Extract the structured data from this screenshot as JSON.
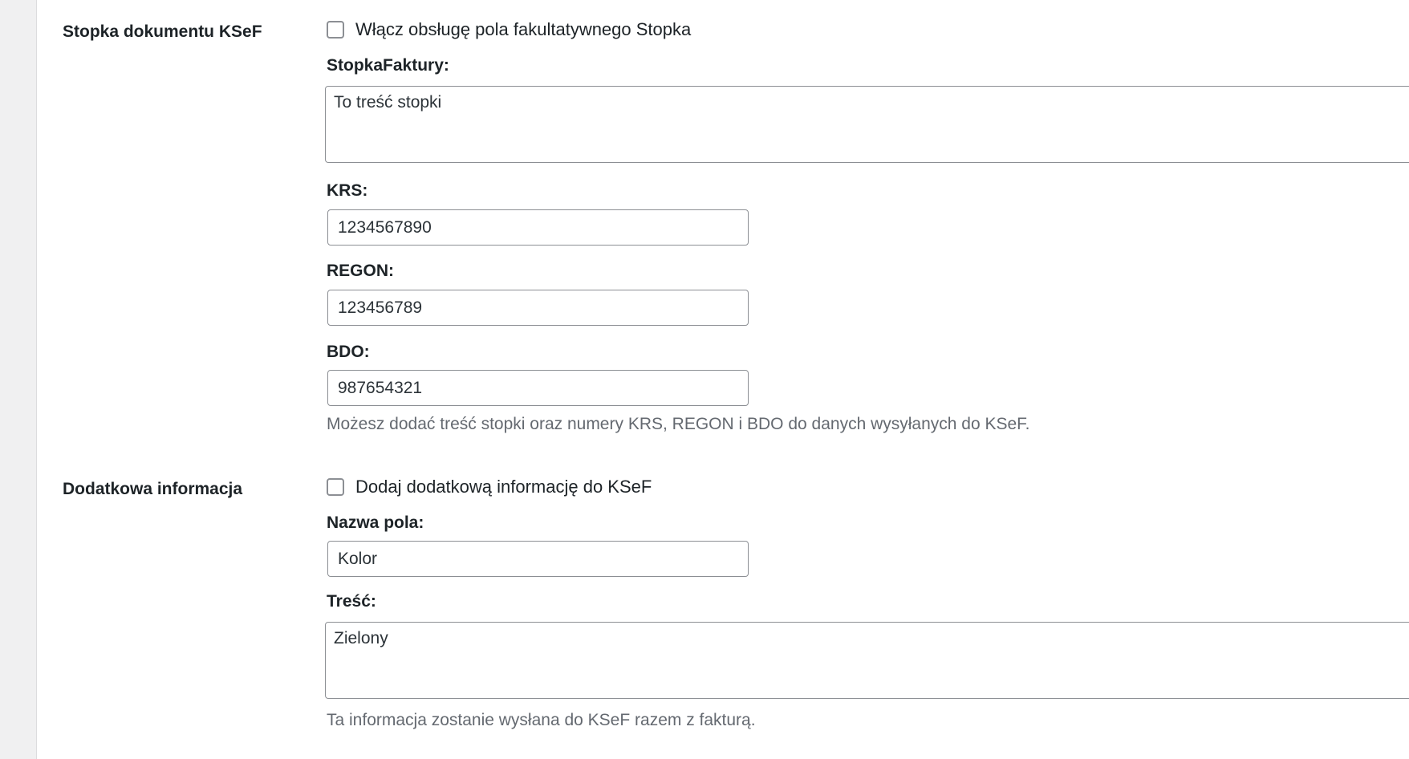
{
  "footer_section": {
    "row_label": "Stopka dokumentu KSeF",
    "checkbox_label": "Włącz obsługę pola fakultatywnego Stopka",
    "checkbox_checked": false,
    "stopka_label": "StopkaFaktury:",
    "stopka_value": "To treść stopki",
    "krs_label": "KRS:",
    "krs_value": "1234567890",
    "regon_label": "REGON:",
    "regon_value": "123456789",
    "bdo_label": "BDO:",
    "bdo_value": "987654321",
    "description": "Możesz dodać treść stopki oraz numery KRS, REGON i BDO do danych wysyłanych do KSeF."
  },
  "extra_info_section": {
    "row_label": "Dodatkowa informacja",
    "checkbox_label": "Dodaj dodatkową informację do KSeF",
    "checkbox_checked": false,
    "name_label": "Nazwa pola:",
    "name_value": "Kolor",
    "content_label": "Treść:",
    "content_value": "Zielony",
    "description": "Ta informacja zostanie wysłana do KSeF razem z fakturą."
  }
}
